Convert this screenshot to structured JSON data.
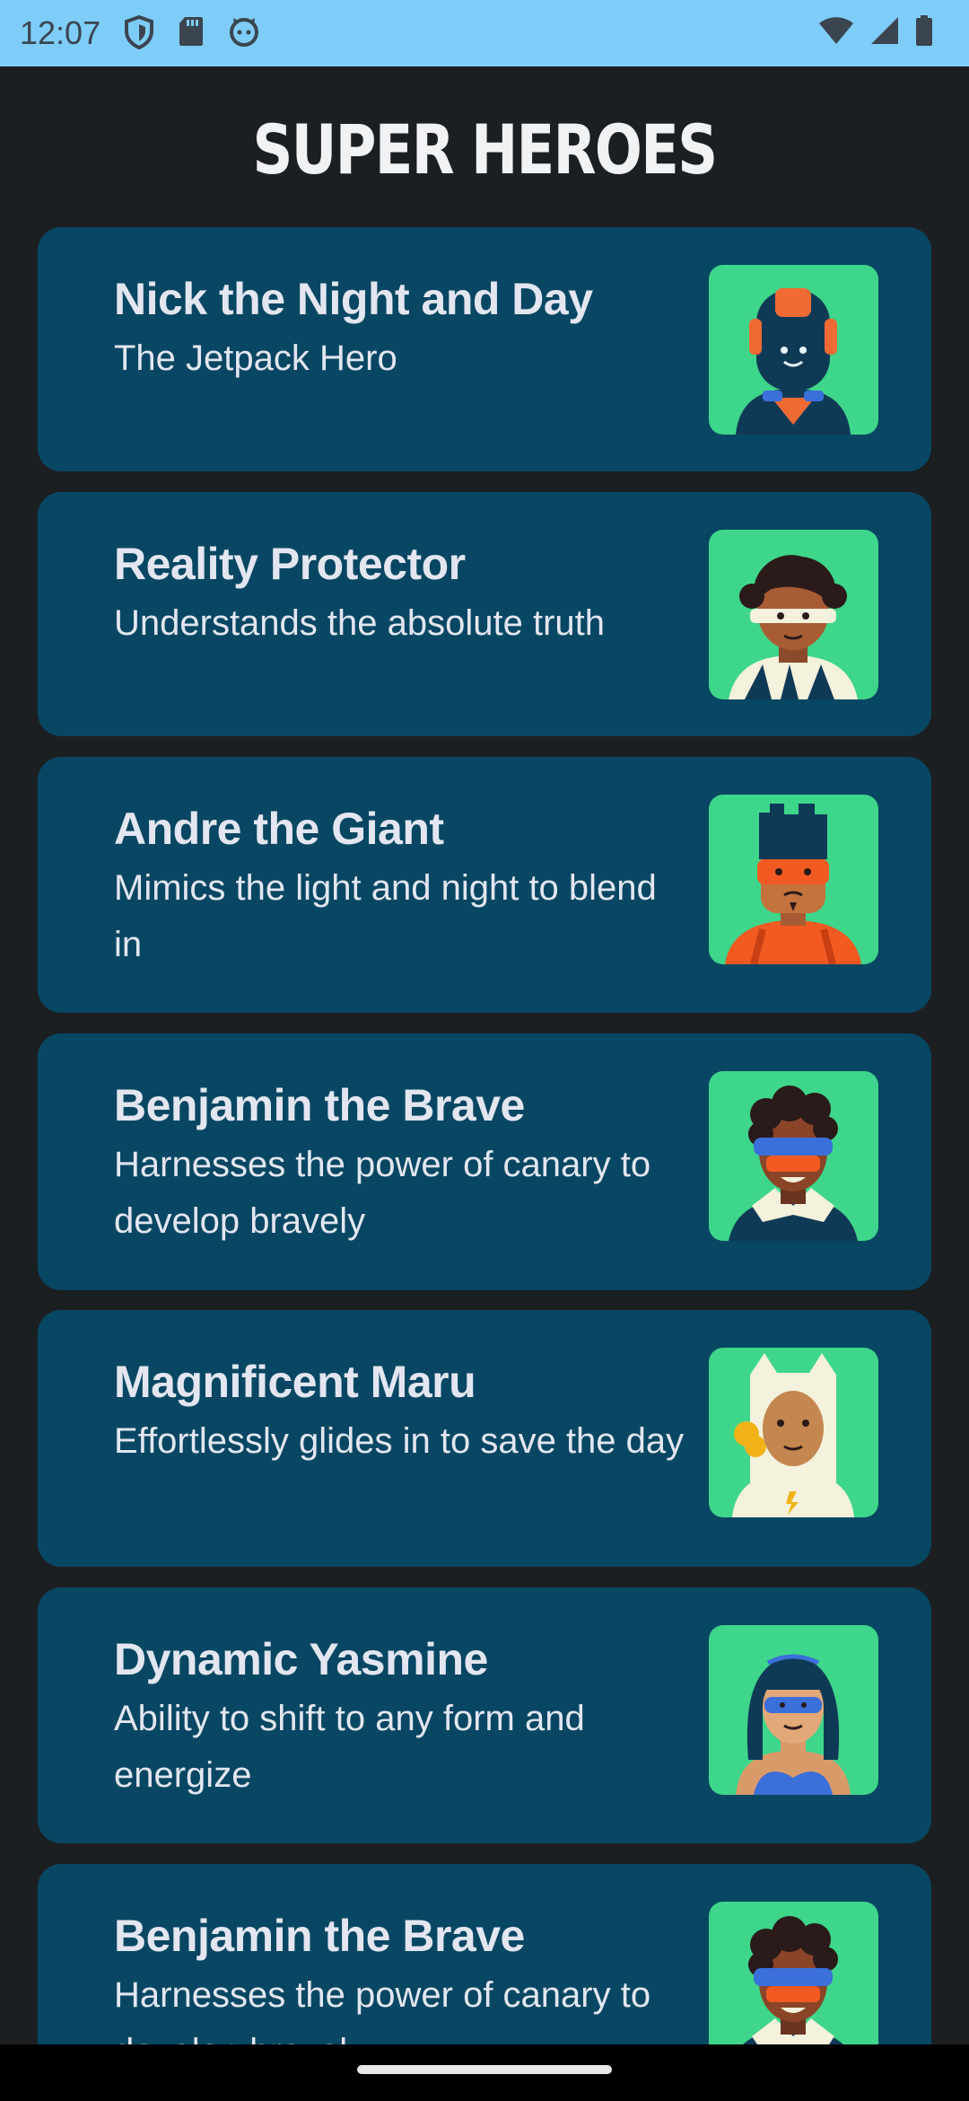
{
  "status_bar": {
    "time": "12:07",
    "left_icons": [
      "shield-icon",
      "sd-card-icon",
      "cat-face-icon"
    ],
    "right_icons": [
      "wifi-icon",
      "cell-signal-icon",
      "battery-icon"
    ]
  },
  "header": {
    "title": "SUPER HEROES"
  },
  "heroes": [
    {
      "name": "Nick the Night and Day",
      "description": "The Jetpack Hero",
      "avatar": "robot-hero-avatar"
    },
    {
      "name": "Reality Protector",
      "description": "Understands the absolute truth",
      "avatar": "curly-hair-hero-avatar"
    },
    {
      "name": "Andre the Giant",
      "description": "Mimics the light and night to blend in",
      "avatar": "masked-hero-avatar"
    },
    {
      "name": "Benjamin the Brave",
      "description": "Harnesses the power of canary to develop bravely",
      "avatar": "goggles-hero-avatar"
    },
    {
      "name": "Magnificent Maru",
      "description": "Effortlessly glides in to save the day",
      "avatar": "hooded-hero-avatar"
    },
    {
      "name": "Dynamic Yasmine",
      "description": "Ability to shift to any form and energize",
      "avatar": "tiara-hero-avatar"
    },
    {
      "name": "Benjamin the Brave",
      "description": "Harnesses the power of canary to develop bravely",
      "avatar": "goggles-hero-avatar"
    }
  ],
  "colors": {
    "background": "#1c1f22",
    "card": "#074763",
    "avatar_bg": "#3ed68a",
    "status_bar": "#7ecdf9",
    "text": "#e3e6f1"
  }
}
